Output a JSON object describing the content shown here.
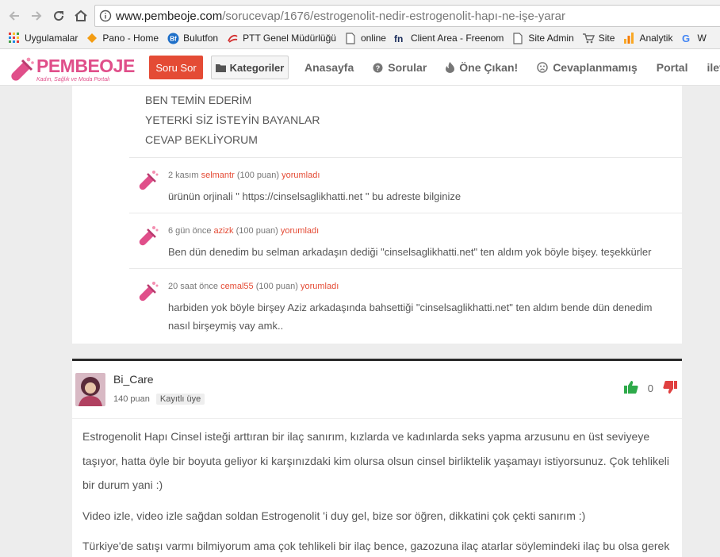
{
  "browser": {
    "url_host": "www.pembeoje.com",
    "url_path": "/sorucevap/1676/estrogenolit-nedir-estrogenolit-hapı-ne-işe-yarar",
    "bookmarks": [
      {
        "label": "Uygulamalar",
        "icon": "apps-grid-icon"
      },
      {
        "label": "Pano - Home",
        "icon": "diamond-icon"
      },
      {
        "label": "Bulutfon",
        "icon": "bulutfon-icon"
      },
      {
        "label": "PTT Genel Müdürlüğü",
        "icon": "ptt-icon"
      },
      {
        "label": "online",
        "icon": "page-icon"
      },
      {
        "label": "Client Area - Freenom",
        "icon": "freenom-icon"
      },
      {
        "label": "Site Admin",
        "icon": "page-icon"
      },
      {
        "label": "Site",
        "icon": "cart-icon"
      },
      {
        "label": "Analytik",
        "icon": "analytics-icon"
      },
      {
        "label": "W",
        "icon": "google-icon"
      }
    ]
  },
  "site": {
    "logo_text": "PEMBEOJE",
    "logo_tagline": "Kadın, Sağlık ve Moda Portalı",
    "ask_button": "Soru Sor",
    "categories_button": "Kategoriler",
    "menu": [
      {
        "label": "Anasayfa",
        "icon": ""
      },
      {
        "label": "Sorular",
        "icon": "question-circle-icon"
      },
      {
        "label": "Öne Çıkan!",
        "icon": "fire-icon"
      },
      {
        "label": "Cevaplanmamış",
        "icon": "frown-icon"
      },
      {
        "label": "Portal",
        "icon": ""
      },
      {
        "label": "iletişi",
        "icon": ""
      }
    ],
    "accent_color": "#e44b35",
    "brand_color": "#e04f8a"
  },
  "answer1": {
    "lines": [
      "BEN TEMİN EDERİM",
      "YETERKİ SİZ İSTEYİN BAYANLAR",
      "CEVAP BEKLİYORUM"
    ]
  },
  "comments": [
    {
      "time": "2 kasım",
      "user": "selmantr",
      "points": "(100 puan)",
      "action": "yorumladı",
      "text": "ürünün orjinali \" https://cinselsaglikhatti.net \" bu adreste bilginize"
    },
    {
      "time": "6 gün önce",
      "user": "azizk",
      "points": "(100 puan)",
      "action": "yorumladı",
      "text": "Ben dün denedim bu selman arkadaşın dediği \"cinselsaglikhatti.net\" ten aldım yok böyle bişey. teşekkürler"
    },
    {
      "time": "20 saat önce",
      "user": "cemal55",
      "points": "(100 puan)",
      "action": "yorumladı",
      "text": "harbiden yok böyle birşey Aziz arkadaşında bahsettiği \"cinselsaglikhatti.net\" ten aldım bende dün denedim nasıl birşeymiş vay amk.."
    }
  ],
  "answer2": {
    "name": "Bi_Care",
    "points": "140 puan",
    "badge": "Kayıtlı üye",
    "votes": "0",
    "paragraphs": [
      "Estrogenolit Hapı Cinsel isteği arttıran bir ilaç sanırım, kızlarda ve kadınlarda seks yapma arzusunu en üst seviyeye taşıyor, hatta öyle bir boyuta geliyor ki karşınızdaki kim olursa olsun cinsel birliktelik yaşamayı istiyorsunuz. Çok tehlikeli bir durum yani :)",
      "Video izle, video izle sağdan soldan Estrogenolit 'i duy gel, bize sor öğren, dikkatini çok çekti sanırım :)",
      "Türkiye'de satışı varmı bilmiyorum ama çok tehlikeli bir ilaç bence, gazozuna ilaç atarlar söylemindeki ilaç bu olsa gerek"
    ]
  }
}
